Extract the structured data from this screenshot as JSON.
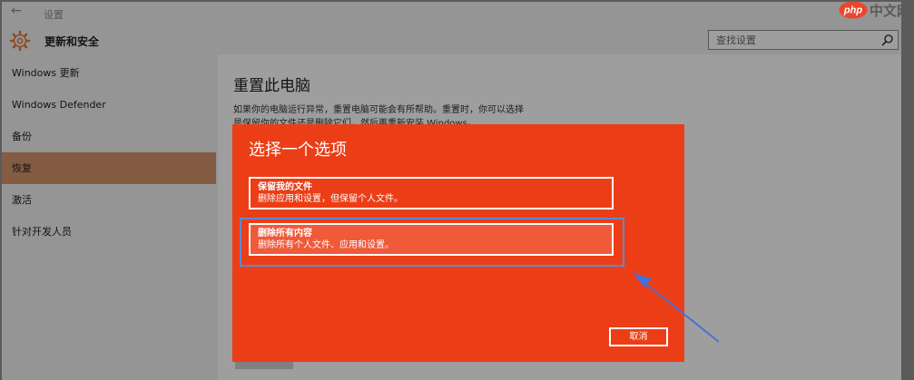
{
  "window": {
    "back_glyph": "←",
    "title": "设置"
  },
  "header": {
    "title": "更新和安全",
    "search_placeholder": "查找设置"
  },
  "sidebar": {
    "items": [
      {
        "label": "Windows 更新",
        "active": false
      },
      {
        "label": "Windows Defender",
        "active": false
      },
      {
        "label": "备份",
        "active": false
      },
      {
        "label": "恢复",
        "active": true
      },
      {
        "label": "激活",
        "active": false
      },
      {
        "label": "针对开发人员",
        "active": false
      }
    ]
  },
  "content": {
    "title": "重置此电脑",
    "description": "如果你的电脑运行异常，重置电脑可能会有所帮助。重置时，你可以选择是保留你的文件还是删除它们，然后再重新安装 Windows。"
  },
  "dialog": {
    "title": "选择一个选项",
    "options": [
      {
        "title": "保留我的文件",
        "description": "删除应用和设置，但保留个人文件。"
      },
      {
        "title": "删除所有内容",
        "description": "删除所有个人文件、应用和设置。"
      }
    ],
    "cancel_label": "取消"
  },
  "watermark": {
    "brand": "php",
    "text": "中文网"
  },
  "colors": {
    "dialog_bg": "#eb3e17",
    "active_nav": "#d3956c",
    "highlight": "#5a8ad8",
    "gear": "#e07c3a"
  }
}
